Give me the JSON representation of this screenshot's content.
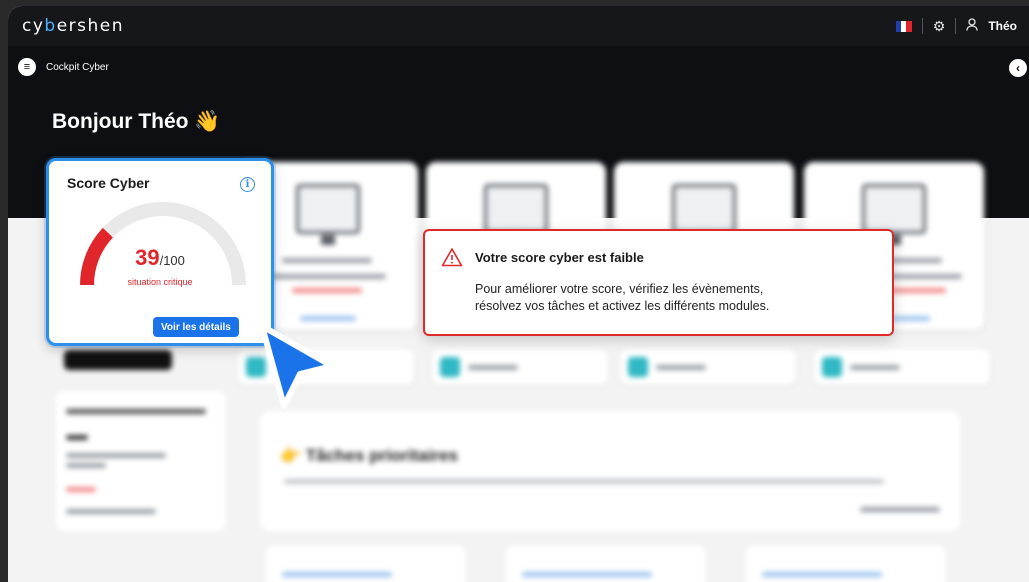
{
  "app": {
    "logo_prefix": "cy",
    "logo_accent": "b",
    "logo_suffix": "ershen"
  },
  "topbar": {
    "user_name": "Théo",
    "language_flag_colors": [
      "#1f3fa8",
      "#ffffff",
      "#e1262b"
    ]
  },
  "subbar": {
    "title": "Cockpit Cyber"
  },
  "hero": {
    "greeting": "Bonjour Théo 👋"
  },
  "score_card": {
    "title": "Score Cyber",
    "score": "39",
    "max": "/100",
    "score_fraction": 0.39,
    "status": "situation critique",
    "details_button": "Voir les détails",
    "gauge_fill_color": "#e0262b",
    "gauge_track_color": "#e9e9e9"
  },
  "alert": {
    "title": "Votre score cyber est faible",
    "body_line1": "Pour améliorer votre score, vérifiez les évènements,",
    "body_line2": "résolvez vos tâches et activez les différents modules.",
    "border_color": "#e02a2a"
  },
  "tasks": {
    "title": "👉 Tâches prioritaires"
  },
  "colors": {
    "accent": "#1a73e8",
    "dark_bg": "#0d0f13",
    "danger": "#e0262b"
  }
}
